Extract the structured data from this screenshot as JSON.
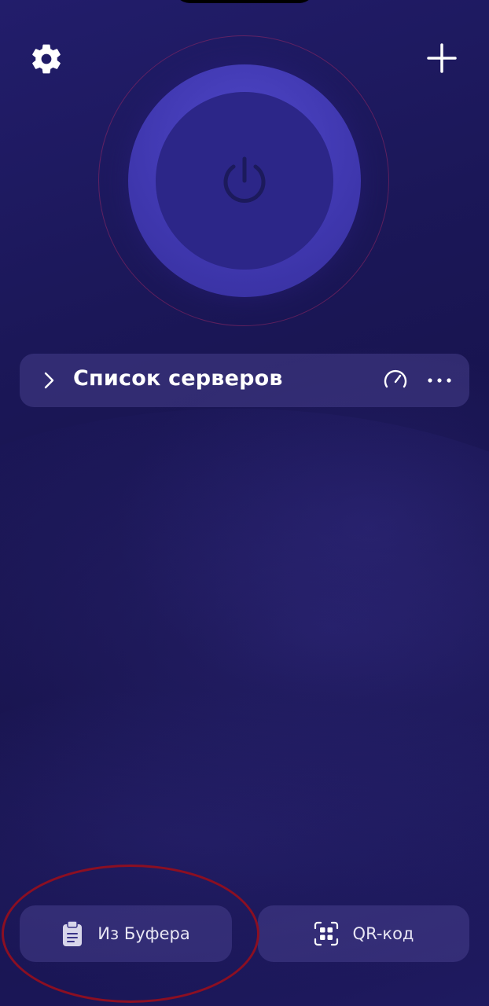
{
  "header": {
    "settings_icon": "gear-icon",
    "add_icon": "plus-icon"
  },
  "connect": {
    "icon": "power-icon",
    "state": "disconnected"
  },
  "server_list": {
    "title": "Список серверов",
    "expand_icon": "chevron-right-icon",
    "speed_icon": "speedometer-icon",
    "more_icon": "more-horizontal-icon"
  },
  "bottom_actions": {
    "clipboard": {
      "label": "Из Буфера",
      "icon": "clipboard-icon"
    },
    "qr": {
      "label": "QR-код",
      "icon": "qr-scan-icon"
    }
  },
  "colors": {
    "background": "#1b1758",
    "button_accent": "#4038b0",
    "button_inner": "#2c2688",
    "annotation": "#8c0f22"
  }
}
